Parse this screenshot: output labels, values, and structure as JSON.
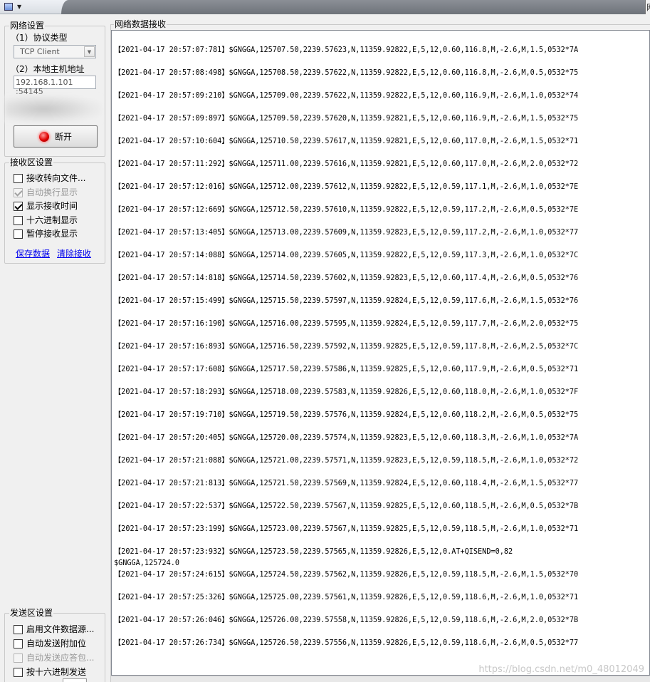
{
  "network": {
    "legend": "网络设置",
    "protocol_label": "（1）协议类型",
    "protocol_value": "TCP Client",
    "host_label": "（2）本地主机地址",
    "host_value": "192.168.1.101 :54145",
    "disconnect_button": "断开"
  },
  "receive_settings": {
    "legend": "接收区设置",
    "options": [
      {
        "label": "接收转向文件...",
        "checked": false,
        "disabled": false
      },
      {
        "label": "自动换行显示",
        "checked": true,
        "disabled": true
      },
      {
        "label": "显示接收时间",
        "checked": true,
        "disabled": false
      },
      {
        "label": "十六进制显示",
        "checked": false,
        "disabled": false
      },
      {
        "label": "暂停接收显示",
        "checked": false,
        "disabled": false
      }
    ],
    "save_link": "保存数据",
    "clear_link": "清除接收"
  },
  "send_settings": {
    "legend": "发送区设置",
    "options": [
      {
        "label": "启用文件数据源...",
        "checked": false,
        "disabled": false
      },
      {
        "label": "自动发送附加位",
        "checked": false,
        "disabled": false
      },
      {
        "label": "自动发送应答包...",
        "checked": false,
        "disabled": true
      },
      {
        "label": "按十六进制发送",
        "checked": false,
        "disabled": false
      }
    ]
  },
  "receive_area": {
    "legend": "网络数据接收",
    "lines": [
      "【2021-04-17 20:57:07:781】$GNGGA,125707.50,2239.57623,N,11359.92822,E,5,12,0.60,116.8,M,-2.6,M,1.5,0532*7A",
      "【2021-04-17 20:57:08:498】$GNGGA,125708.50,2239.57622,N,11359.92822,E,5,12,0.60,116.8,M,-2.6,M,0.5,0532*75",
      "【2021-04-17 20:57:09:210】$GNGGA,125709.00,2239.57622,N,11359.92822,E,5,12,0.60,116.9,M,-2.6,M,1.0,0532*74",
      "【2021-04-17 20:57:09:897】$GNGGA,125709.50,2239.57620,N,11359.92821,E,5,12,0.60,116.9,M,-2.6,M,1.5,0532*75",
      "【2021-04-17 20:57:10:604】$GNGGA,125710.50,2239.57617,N,11359.92821,E,5,12,0.60,117.0,M,-2.6,M,1.5,0532*71",
      "【2021-04-17 20:57:11:292】$GNGGA,125711.00,2239.57616,N,11359.92821,E,5,12,0.60,117.0,M,-2.6,M,2.0,0532*72",
      "【2021-04-17 20:57:12:016】$GNGGA,125712.00,2239.57612,N,11359.92822,E,5,12,0.59,117.1,M,-2.6,M,1.0,0532*7E",
      "【2021-04-17 20:57:12:669】$GNGGA,125712.50,2239.57610,N,11359.92822,E,5,12,0.59,117.2,M,-2.6,M,0.5,0532*7E",
      "【2021-04-17 20:57:13:405】$GNGGA,125713.00,2239.57609,N,11359.92823,E,5,12,0.59,117.2,M,-2.6,M,1.0,0532*77",
      "【2021-04-17 20:57:14:088】$GNGGA,125714.00,2239.57605,N,11359.92822,E,5,12,0.59,117.3,M,-2.6,M,1.0,0532*7C",
      "【2021-04-17 20:57:14:818】$GNGGA,125714.50,2239.57602,N,11359.92823,E,5,12,0.60,117.4,M,-2.6,M,0.5,0532*76",
      "【2021-04-17 20:57:15:499】$GNGGA,125715.50,2239.57597,N,11359.92824,E,5,12,0.59,117.6,M,-2.6,M,1.5,0532*76",
      "【2021-04-17 20:57:16:190】$GNGGA,125716.00,2239.57595,N,11359.92824,E,5,12,0.59,117.7,M,-2.6,M,2.0,0532*75",
      "【2021-04-17 20:57:16:893】$GNGGA,125716.50,2239.57592,N,11359.92825,E,5,12,0.59,117.8,M,-2.6,M,2.5,0532*7C",
      "【2021-04-17 20:57:17:608】$GNGGA,125717.50,2239.57586,N,11359.92825,E,5,12,0.60,117.9,M,-2.6,M,0.5,0532*71",
      "【2021-04-17 20:57:18:293】$GNGGA,125718.00,2239.57583,N,11359.92826,E,5,12,0.60,118.0,M,-2.6,M,1.0,0532*7F",
      "【2021-04-17 20:57:19:710】$GNGGA,125719.50,2239.57576,N,11359.92824,E,5,12,0.60,118.2,M,-2.6,M,0.5,0532*75",
      "【2021-04-17 20:57:20:405】$GNGGA,125720.00,2239.57574,N,11359.92823,E,5,12,0.60,118.3,M,-2.6,M,1.0,0532*7A",
      "【2021-04-17 20:57:21:088】$GNGGA,125721.00,2239.57571,N,11359.92823,E,5,12,0.59,118.5,M,-2.6,M,1.0,0532*72",
      "【2021-04-17 20:57:21:813】$GNGGA,125721.50,2239.57569,N,11359.92824,E,5,12,0.60,118.4,M,-2.6,M,1.5,0532*77",
      "【2021-04-17 20:57:22:537】$GNGGA,125722.50,2239.57567,N,11359.92825,E,5,12,0.60,118.5,M,-2.6,M,0.5,0532*7B",
      "【2021-04-17 20:57:23:199】$GNGGA,125723.00,2239.57567,N,11359.92825,E,5,12,0.59,118.5,M,-2.6,M,1.0,0532*71",
      "【2021-04-17 20:57:23:932】$GNGGA,125723.50,2239.57565,N,11359.92826,E,5,12,0.AT+QISEND=0,82",
      "$GNGGA,125724.0",
      "【2021-04-17 20:57:24:615】$GNGGA,125724.50,2239.57562,N,11359.92826,E,5,12,0.59,118.5,M,-2.6,M,1.5,0532*70",
      "【2021-04-17 20:57:25:326】$GNGGA,125725.00,2239.57561,N,11359.92826,E,5,12,0.59,118.6,M,-2.6,M,1.0,0532*71",
      "【2021-04-17 20:57:26:046】$GNGGA,125726.00,2239.57558,N,11359.92826,E,5,12,0.59,118.6,M,-2.6,M,2.0,0532*7B",
      "【2021-04-17 20:57:26:734】$GNGGA,125726.50,2239.57556,N,11359.92826,E,5,12,0.59,118.6,M,-2.6,M,0.5,0532*77"
    ]
  },
  "watermark": "https://blog.csdn.net/m0_48012049"
}
